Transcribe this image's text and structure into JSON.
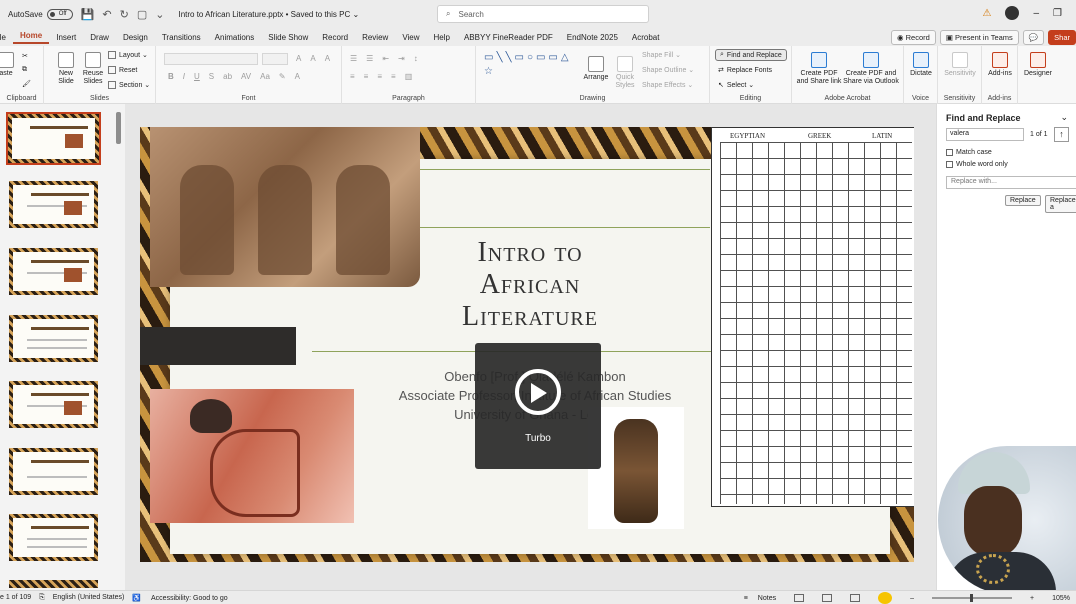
{
  "titlebar": {
    "autosave_label": "AutoSave",
    "autosave_state": "Off",
    "doc_title": "Intro to African Literature.pptx • Saved to this PC ⌄",
    "search_placeholder": "Search"
  },
  "tabs": [
    "ile",
    "Home",
    "Insert",
    "Draw",
    "Design",
    "Transitions",
    "Animations",
    "Slide Show",
    "Record",
    "Review",
    "View",
    "Help",
    "ABBYY FineReader PDF",
    "EndNote 2025",
    "Acrobat"
  ],
  "tab_actions": {
    "record": "Record",
    "present": "Present in Teams",
    "share": "Shar"
  },
  "ribbon": {
    "clipboard": {
      "paste": "aste",
      "label": "Clipboard"
    },
    "slides": {
      "new": "New Slide",
      "reuse": "Reuse Slides",
      "layout": "Layout ⌄",
      "reset": "Reset",
      "section": "Section ⌄",
      "label": "Slides"
    },
    "font": {
      "label": "Font"
    },
    "paragraph": {
      "label": "Paragraph"
    },
    "drawing": {
      "arrange": "Arrange",
      "quick_styles": "Quick Styles",
      "shape_fill": "Shape Fill ⌄",
      "shape_outline": "Shape Outline ⌄",
      "shape_effects": "Shape Effects ⌄",
      "label": "Drawing"
    },
    "editing": {
      "find_replace": "Find and Replace",
      "replace_fonts": "Replace Fonts",
      "select": "Select ⌄",
      "label": "Editing"
    },
    "acrobat": {
      "create_pdf": "Create PDF and Share link",
      "create_pdf_outlook": "Create PDF and Share via Outlook",
      "label": "Adobe Acrobat"
    },
    "voice": {
      "dictate": "Dictate",
      "label": "Voice"
    },
    "sensitivity": {
      "btn": "Sensitivity",
      "label": "Sensitivity"
    },
    "addins": {
      "btn": "Add-ins",
      "label": "Add-ins"
    },
    "designer": {
      "btn": "Designer"
    }
  },
  "slide": {
    "title": "Intro to African Literature",
    "title_lines": [
      "Intro to",
      "African",
      "Literature"
    ],
    "subtitle_lines": [
      "Obenfo [Prof.] Ọ̀ládélé Kambon",
      "Associate Professor, Institute of African Studies",
      "University of Ghana - Legon"
    ],
    "chart_headers": {
      "egyptian": "EGYPTIAN",
      "greek": "GREEK",
      "latin": "LATIN"
    }
  },
  "overlay": {
    "label": "Turbo"
  },
  "find_pane": {
    "title": "Find and Replace",
    "query": "valera",
    "count": "1 of 1",
    "match_case": "Match case",
    "whole_word": "Whole word only",
    "replace_placeholder": "Replace with...",
    "replace_btn": "Replace",
    "replace_all_btn": "Replace a"
  },
  "status": {
    "slide_count": "e 1 of 109",
    "language": "English (United States)",
    "accessibility": "Accessibility: Good to go",
    "notes": "Notes",
    "zoom": "105%"
  },
  "colors": {
    "accent": "#b7472a",
    "share": "#c43e1c"
  }
}
